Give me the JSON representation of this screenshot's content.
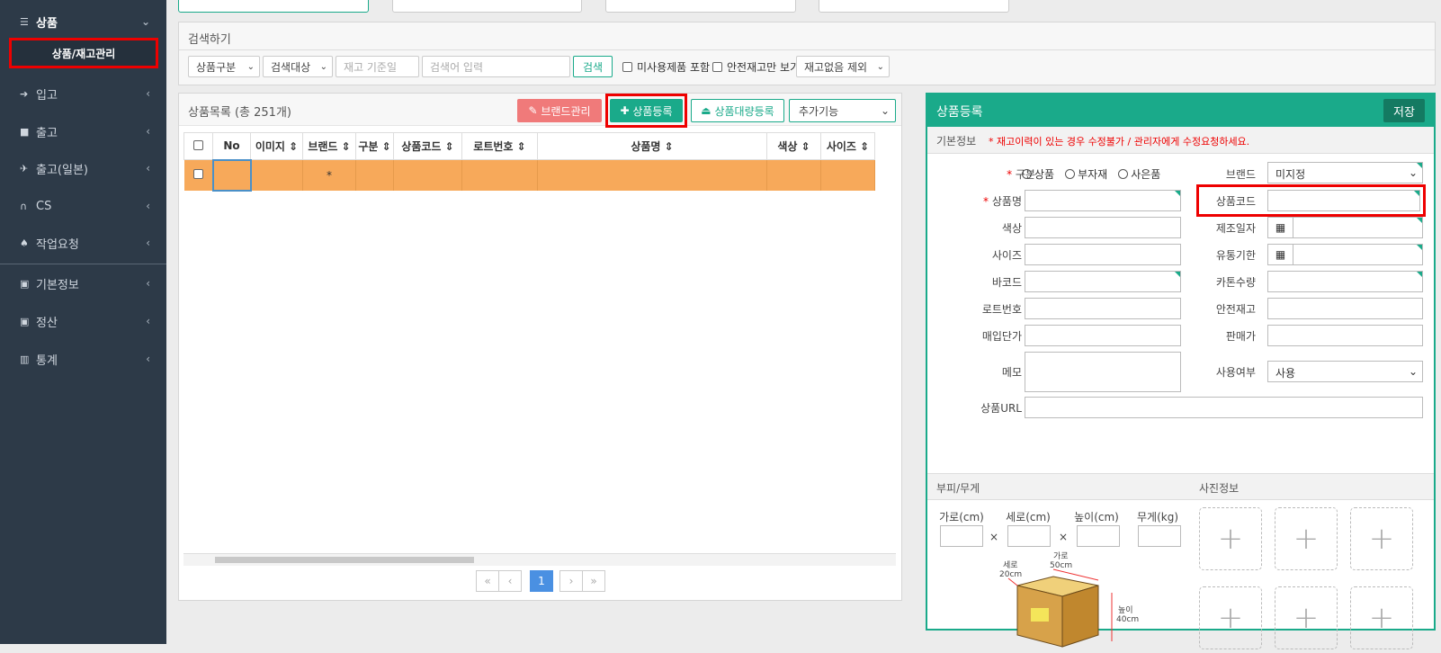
{
  "sidebar": {
    "product": "상품",
    "product_sub": "상품/재고관리",
    "items": [
      {
        "label": "입고",
        "icon": "sign-in-icon"
      },
      {
        "label": "출고",
        "icon": "truck-icon"
      },
      {
        "label": "출고(일본)",
        "icon": "plane-icon"
      },
      {
        "label": "CS",
        "icon": "headset-icon"
      },
      {
        "label": "작업요청",
        "icon": "shirt-icon"
      },
      {
        "label": "기본정보",
        "icon": "idcard-icon"
      },
      {
        "label": "정산",
        "icon": "idcard-icon"
      },
      {
        "label": "통계",
        "icon": "barchart-icon"
      }
    ]
  },
  "search": {
    "title": "검색하기",
    "type_select": "상품구분",
    "target_select": "검색대상",
    "date_placeholder": "재고 기준일",
    "keyword_placeholder": "검색어 입력",
    "search_button": "검색",
    "chk_unused": "미사용제품 포함",
    "chk_safety": "안전재고만 보기",
    "stock_select": "재고없음 제외"
  },
  "list": {
    "title": "상품목록 (총 251개)",
    "brand_btn": "브랜드관리",
    "register_btn": "상품등록",
    "bulk_btn": "상품대량등록",
    "extra_select": "추가기능",
    "columns": [
      "No",
      "이미지",
      "브랜드",
      "구분",
      "상품코드",
      "로트번호",
      "상품명",
      "색상",
      "사이즈"
    ],
    "row_brand": "*",
    "page": "1"
  },
  "register": {
    "title": "상품등록",
    "save": "저장",
    "basic_info": "기본정보",
    "warning": "* 재고이력이 있는 경우 수정불가 / 관리자에게 수정요청하세요.",
    "type_label": "구분",
    "type_options": [
      "상품",
      "부자재",
      "사은품"
    ],
    "brand_label": "브랜드",
    "brand_value": "미지정",
    "name_label": "상품명",
    "code_label": "상품코드",
    "color_label": "색상",
    "mfg_label": "제조일자",
    "size_label": "사이즈",
    "expiry_label": "유통기한",
    "barcode_label": "바코드",
    "carton_label": "카톤수량",
    "lot_label": "로트번호",
    "safety_label": "안전재고",
    "buy_label": "매입단가",
    "sell_label": "판매가",
    "memo_label": "메모",
    "use_label": "사용여부",
    "use_value": "사용",
    "url_label": "상품URL",
    "volume_title": "부피/무게",
    "photo_title": "사진정보",
    "width_label": "가로(cm)",
    "depth_label": "세로(cm)",
    "height_label": "높이(cm)",
    "weight_label": "무게(kg)",
    "times": "×",
    "box_w": "가로",
    "box_w_val": "50cm",
    "box_d": "세로",
    "box_d_val": "20cm",
    "box_h": "높이",
    "box_h_val": "40cm"
  }
}
